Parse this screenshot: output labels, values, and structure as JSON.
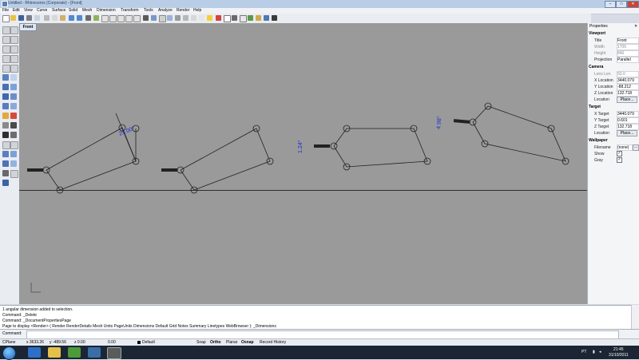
{
  "window": {
    "title": "Untitled - Rhinoceros (Corporate) - [Front]"
  },
  "menu": {
    "items": [
      "File",
      "Edit",
      "View",
      "Curve",
      "Surface",
      "Solid",
      "Mesh",
      "Dimension",
      "Transform",
      "Tools",
      "Analyze",
      "Render",
      "Help"
    ]
  },
  "viewport": {
    "tab_label": "Front"
  },
  "dimensions": {
    "angle1": "25.00°",
    "angle2": "1.24°",
    "angle3": "4.98°"
  },
  "properties": {
    "panel_title": "Properties",
    "viewport_section": "Viewport",
    "title_label": "Title",
    "title_value": "Front",
    "width_label": "Width",
    "width_value": "1705",
    "height_label": "Height",
    "height_value": "846",
    "projection_label": "Projection",
    "projection_value": "Parallel",
    "camera_section": "Camera",
    "lens_label": "Lens Len",
    "lens_value": "50.0",
    "xloc_label": "X Location",
    "xloc_value": "3440.079",
    "yloc_label": "Y Location",
    "yloc_value": "-88.212",
    "zloc_label": "Z Location",
    "zloc_value": "132.718",
    "location_label": "Location",
    "place_label": "Place...",
    "target_section": "Target",
    "xtarget_label": "X Target",
    "xtarget_value": "3440.079",
    "ytarget_label": "Y Target",
    "ytarget_value": "0.601",
    "ztarget_label": "Z Target",
    "ztarget_value": "132.718",
    "tlocation_label": "Location",
    "tplace_label": "Place...",
    "wallpaper_section": "Wallpaper",
    "filename_label": "Filename",
    "filename_value": "(none)",
    "show_label": "Show",
    "gray_label": "Gray"
  },
  "command_history": {
    "lines": [
      "1 angular dimension added to selection.",
      "Command: _Delete",
      "Command: _DocumentPropertiesPage",
      "Page to display <Render> ( Render RenderDetails Mesh Units PageUnits Dimensions Default Grid Notes Summary Linetypes WebBrowser ): _Dimensions"
    ]
  },
  "command": {
    "label": "Command:"
  },
  "status": {
    "cplane": "CPlane",
    "x": "x 3633.26",
    "y": "y -489.56",
    "z": "z 0.00",
    "extra": "0.00",
    "layer": "Default",
    "snap": "Snap",
    "ortho": "Ortho",
    "planar": "Planar",
    "osnap": "Osnap",
    "history": "Record History"
  },
  "tray": {
    "lang": "PT",
    "time": "21:45",
    "date": "31/10/2011"
  },
  "colors": {
    "viewport_bg": "#9a9a9a",
    "dim_text": "#1c2bd8"
  }
}
